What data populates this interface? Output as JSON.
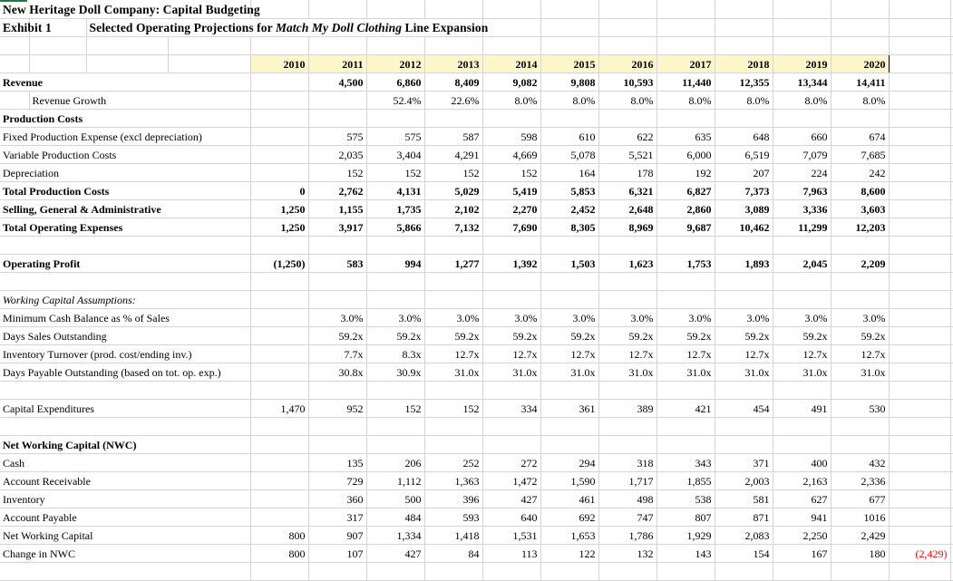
{
  "document": {
    "title_line1": "New Heritage Doll Company: Capital Budgeting",
    "exhibit_label": "Exhibit 1",
    "exhibit_title_pre": "Selected Operating Projections for ",
    "exhibit_title_italic": "Match My Doll Clothing",
    "exhibit_title_post": " Line Expansion"
  },
  "colors": {
    "header_band": "#fdf6c8",
    "gridline": "#d4d4d4",
    "negative": "#ff0000",
    "sheet_tab": "#1f7a44"
  },
  "years": [
    "2010",
    "2011",
    "2012",
    "2013",
    "2014",
    "2015",
    "2016",
    "2017",
    "2018",
    "2019",
    "2020"
  ],
  "rows": [
    {
      "id": "revenue",
      "label": "Revenue",
      "style": "bold",
      "values": [
        "",
        "4,500",
        "6,860",
        "8,409",
        "9,082",
        "9,808",
        "10,593",
        "11,440",
        "12,355",
        "13,344",
        "14,411"
      ],
      "tail": ""
    },
    {
      "id": "revenue-growth",
      "label": "Revenue Growth",
      "style": "indent",
      "values": [
        "",
        "",
        "52.4%",
        "22.6%",
        "8.0%",
        "8.0%",
        "8.0%",
        "8.0%",
        "8.0%",
        "8.0%",
        "8.0%"
      ],
      "tail": ""
    },
    {
      "id": "production-costs",
      "label": "Production Costs",
      "style": "bold",
      "values": [
        "",
        "",
        "",
        "",
        "",
        "",
        "",
        "",
        "",
        "",
        ""
      ],
      "tail": ""
    },
    {
      "id": "fixed-production-expense",
      "label": "Fixed Production Expense (excl depreciation)",
      "style": "normal",
      "values": [
        "",
        "575",
        "575",
        "587",
        "598",
        "610",
        "622",
        "635",
        "648",
        "660",
        "674"
      ],
      "tail": ""
    },
    {
      "id": "variable-production-costs",
      "label": "Variable Production Costs",
      "style": "normal",
      "values": [
        "",
        "2,035",
        "3,404",
        "4,291",
        "4,669",
        "5,078",
        "5,521",
        "6,000",
        "6,519",
        "7,079",
        "7,685"
      ],
      "tail": ""
    },
    {
      "id": "depreciation",
      "label": "Depreciation",
      "style": "normal",
      "values": [
        "",
        "152",
        "152",
        "152",
        "152",
        "164",
        "178",
        "192",
        "207",
        "224",
        "242"
      ],
      "tail": ""
    },
    {
      "id": "total-production-costs",
      "label": "Total Production Costs",
      "style": "bold-topline",
      "values": [
        "0",
        "2,762",
        "4,131",
        "5,029",
        "5,419",
        "5,853",
        "6,321",
        "6,827",
        "7,373",
        "7,963",
        "8,600"
      ],
      "tail": ""
    },
    {
      "id": "sga",
      "label": "Selling, General & Administrative",
      "style": "bold",
      "values": [
        "1,250",
        "1,155",
        "1,735",
        "2,102",
        "2,270",
        "2,452",
        "2,648",
        "2,860",
        "3,089",
        "3,336",
        "3,603"
      ],
      "tail": ""
    },
    {
      "id": "total-operating-expenses",
      "label": "Total Operating Expenses",
      "style": "bold-topline",
      "values": [
        "1,250",
        "3,917",
        "5,866",
        "7,132",
        "7,690",
        "8,305",
        "8,969",
        "9,687",
        "10,462",
        "11,299",
        "12,203"
      ],
      "tail": ""
    },
    {
      "id": "spacer-1",
      "label": "",
      "style": "normal",
      "values": [
        "",
        "",
        "",
        "",
        "",
        "",
        "",
        "",
        "",
        "",
        ""
      ],
      "tail": ""
    },
    {
      "id": "operating-profit",
      "label": "Operating Profit",
      "style": "bold",
      "values": [
        "(1,250)",
        "583",
        "994",
        "1,277",
        "1,392",
        "1,503",
        "1,623",
        "1,753",
        "1,893",
        "2,045",
        "2,209"
      ],
      "tail": ""
    },
    {
      "id": "spacer-2",
      "label": "",
      "style": "normal",
      "values": [
        "",
        "",
        "",
        "",
        "",
        "",
        "",
        "",
        "",
        "",
        ""
      ],
      "tail": ""
    },
    {
      "id": "working-capital-assumptions",
      "label": "Working Capital Assumptions:",
      "style": "italic",
      "values": [
        "",
        "",
        "",
        "",
        "",
        "",
        "",
        "",
        "",
        "",
        ""
      ],
      "tail": ""
    },
    {
      "id": "minimum-cash-balance",
      "label": "Minimum Cash Balance as % of Sales",
      "style": "normal",
      "values": [
        "",
        "3.0%",
        "3.0%",
        "3.0%",
        "3.0%",
        "3.0%",
        "3.0%",
        "3.0%",
        "3.0%",
        "3.0%",
        "3.0%"
      ],
      "tail": ""
    },
    {
      "id": "days-sales-outstanding",
      "label": "Days Sales Outstanding",
      "style": "normal",
      "values": [
        "",
        "59.2x",
        "59.2x",
        "59.2x",
        "59.2x",
        "59.2x",
        "59.2x",
        "59.2x",
        "59.2x",
        "59.2x",
        "59.2x"
      ],
      "tail": ""
    },
    {
      "id": "inventory-turnover",
      "label": "Inventory Turnover (prod. cost/ending inv.)",
      "style": "normal",
      "values": [
        "",
        "7.7x",
        "8.3x",
        "12.7x",
        "12.7x",
        "12.7x",
        "12.7x",
        "12.7x",
        "12.7x",
        "12.7x",
        "12.7x"
      ],
      "tail": ""
    },
    {
      "id": "days-payable-outstanding",
      "label": "Days Payable Outstanding (based on tot. op. exp.)",
      "style": "normal",
      "values": [
        "",
        "30.8x",
        "30.9x",
        "31.0x",
        "31.0x",
        "31.0x",
        "31.0x",
        "31.0x",
        "31.0x",
        "31.0x",
        "31.0x"
      ],
      "tail": ""
    },
    {
      "id": "spacer-3",
      "label": "",
      "style": "normal",
      "values": [
        "",
        "",
        "",
        "",
        "",
        "",
        "",
        "",
        "",
        "",
        ""
      ],
      "tail": ""
    },
    {
      "id": "capital-expenditures",
      "label": "Capital Expenditures",
      "style": "normal",
      "values": [
        "1,470",
        "952",
        "152",
        "152",
        "334",
        "361",
        "389",
        "421",
        "454",
        "491",
        "530"
      ],
      "tail": ""
    },
    {
      "id": "spacer-4",
      "label": "",
      "style": "normal",
      "values": [
        "",
        "",
        "",
        "",
        "",
        "",
        "",
        "",
        "",
        "",
        ""
      ],
      "tail": ""
    },
    {
      "id": "net-working-capital-header",
      "label": "Net Working Capital (NWC)",
      "style": "bold",
      "values": [
        "",
        "",
        "",
        "",
        "",
        "",
        "",
        "",
        "",
        "",
        ""
      ],
      "tail": ""
    },
    {
      "id": "cash",
      "label": "Cash",
      "style": "normal",
      "values": [
        "",
        "135",
        "206",
        "252",
        "272",
        "294",
        "318",
        "343",
        "371",
        "400",
        "432"
      ],
      "tail": ""
    },
    {
      "id": "account-receivable",
      "label": "Account Receivable",
      "style": "normal",
      "values": [
        "",
        "729",
        "1,112",
        "1,363",
        "1,472",
        "1,590",
        "1,717",
        "1,855",
        "2,003",
        "2,163",
        "2,336"
      ],
      "tail": ""
    },
    {
      "id": "inventory",
      "label": "Inventory",
      "style": "normal",
      "values": [
        "",
        "360",
        "500",
        "396",
        "427",
        "461",
        "498",
        "538",
        "581",
        "627",
        "677"
      ],
      "tail": ""
    },
    {
      "id": "account-payable",
      "label": "Account Payable",
      "style": "normal",
      "values": [
        "",
        "317",
        "484",
        "593",
        "640",
        "692",
        "747",
        "807",
        "871",
        "941",
        "1016"
      ],
      "tail": ""
    },
    {
      "id": "net-working-capital",
      "label": "Net Working Capital",
      "style": "normal",
      "values": [
        "800",
        "907",
        "1,334",
        "1,418",
        "1,531",
        "1,653",
        "1,786",
        "1,929",
        "2,083",
        "2,250",
        "2,429"
      ],
      "tail": ""
    },
    {
      "id": "change-in-nwc",
      "label": "Change in NWC",
      "style": "normal",
      "values": [
        "800",
        "107",
        "427",
        "84",
        "113",
        "122",
        "132",
        "143",
        "154",
        "167",
        "180"
      ],
      "tail": "(2,429)"
    },
    {
      "id": "spacer-5",
      "label": "",
      "style": "normal",
      "values": [
        "",
        "",
        "",
        "",
        "",
        "",
        "",
        "",
        "",
        "",
        ""
      ],
      "tail": ""
    }
  ]
}
